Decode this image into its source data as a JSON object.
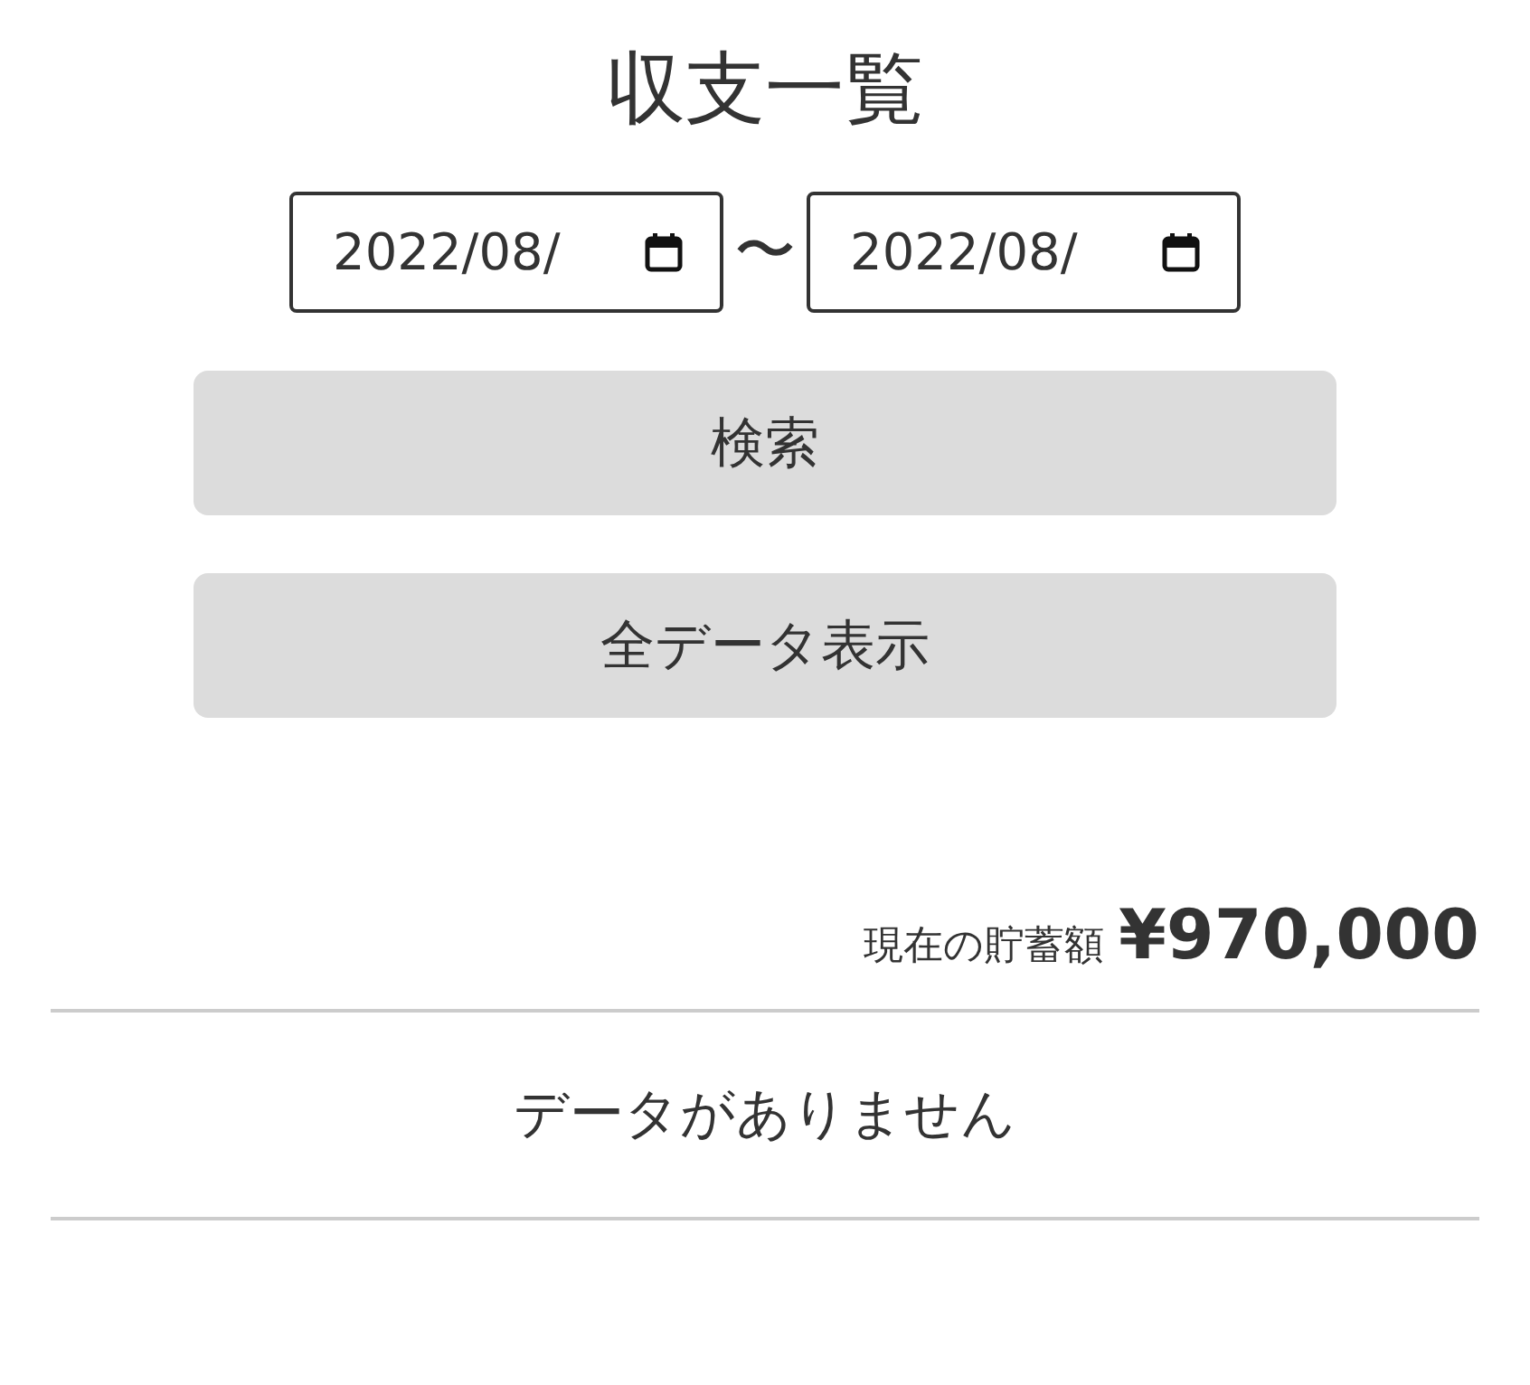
{
  "title": "収支一覧",
  "date_range": {
    "from": {
      "value": "2022/08/"
    },
    "separator": "〜",
    "to": {
      "value": "2022/08/"
    }
  },
  "buttons": [
    {
      "label": "検索"
    },
    {
      "label": "全データ表示"
    }
  ],
  "savings": {
    "label": "現在の貯蓄額",
    "amount": "¥970,000"
  },
  "empty_message": "データがありません"
}
